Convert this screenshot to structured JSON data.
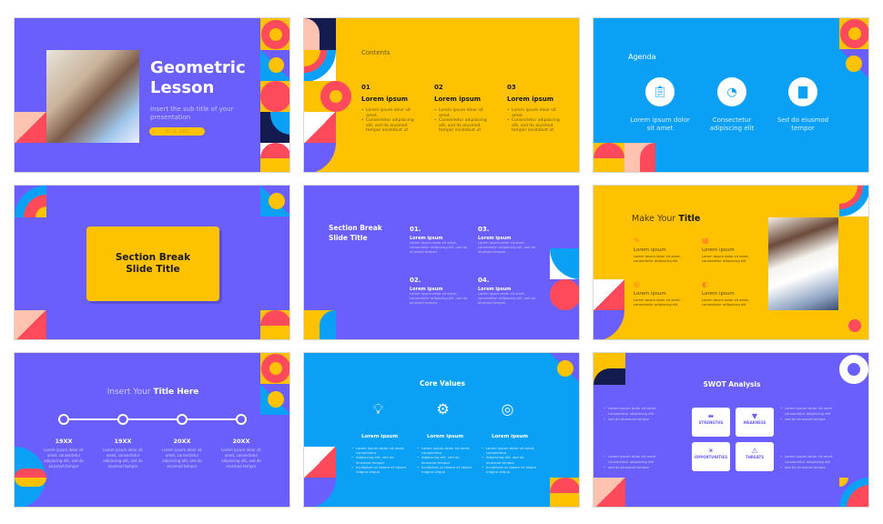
{
  "colors": {
    "purple": "#6a5ffd",
    "yellow": "#fec200",
    "blue": "#0aa0f5",
    "red": "#ff4a5c",
    "navy": "#141c4f",
    "peach": "#ffc3b0"
  },
  "slides": [
    {
      "title_line1": "Geometric",
      "title_line2": "Lesson",
      "subtitle": "Insert the sub title of your presentation",
      "date": "00. 00. 20XX"
    },
    {
      "heading": "Contents",
      "columns": [
        {
          "number": "01",
          "title": "Lorem ipsum",
          "bullets": [
            "Lorem ipsum dolor sit amet.",
            "Consectetur adipisicing elit, sed do eiusmod tempor incididunt ut"
          ]
        },
        {
          "number": "02",
          "title": "Lorem ipsum",
          "bullets": [
            "Lorem ipsum dolor sit amet.",
            "Consectetur adipisicing elit, sed do eiusmod tempor incididunt ut"
          ]
        },
        {
          "number": "03",
          "title": "Lorem ipsum",
          "bullets": [
            "Lorem ipsum dolor sit amet.",
            "Consectetur adipisicing elit, sed do eiusmod tempor incididunt ut"
          ]
        }
      ]
    },
    {
      "heading": "Agenda",
      "items": [
        {
          "icon": "clipboard-icon",
          "label": "Lorem ipsum dolor sit amet"
        },
        {
          "icon": "pie-chart-icon",
          "label": "Consectetur adipiscing elit"
        },
        {
          "icon": "bar-chart-icon",
          "label": "Sed do eiusmod tempor"
        }
      ]
    },
    {
      "title_line1": "Section Break",
      "title_line2": "Slide Title"
    },
    {
      "title_line1": "Section Break",
      "title_line2": "Slide Title",
      "items": [
        {
          "number": "01.",
          "title": "Lorem ipsum",
          "body": "Lorem ipsum dolor sit amet, consectetur adipiscing elit, sed do eiusmod tempor"
        },
        {
          "number": "03.",
          "title": "Lorem ipsum",
          "body": "Lorem ipsum dolor sit amet, consectetur adipiscing elit, sed do eiusmod tempor"
        },
        {
          "number": "02.",
          "title": "Lorem ipsum",
          "body": "Lorem ipsum dolor sit amet, consectetur adipiscing elit, sed do eiusmod tempor"
        },
        {
          "number": "04.",
          "title": "Lorem ipsum",
          "body": "Lorem ipsum dolor sit amet, consectetur adipiscing elit, sed do eiusmod tempor"
        }
      ]
    },
    {
      "title_light": "Make Your ",
      "title_bold": "Title",
      "items": [
        {
          "icon": "edit-icon",
          "title": "Lorem ipsum",
          "body": "Lorem ipsum dolor sit amet, consectetur adipiscing elit"
        },
        {
          "icon": "calendar-icon",
          "title": "Lorem ipsum",
          "body": "Lorem ipsum dolor sit amet, consectetur adipiscing elit"
        },
        {
          "icon": "target-icon",
          "title": "Lorem ipsum",
          "body": "Lorem ipsum dolor sit amet, consectetur adipiscing elit"
        },
        {
          "icon": "palette-icon",
          "title": "Lorem ipsum",
          "body": "Lorem ipsum dolor sit amet, consectetur adipiscing elit"
        }
      ]
    },
    {
      "title_light": "Insert Your ",
      "title_bold": "Title Here",
      "milestones": [
        {
          "year": "19XX",
          "body": "Lorem ipsum dolor sit amet, consectetur adipiscing elit, sed do eiusmod tempor"
        },
        {
          "year": "19XX",
          "body": "Lorem ipsum dolor sit amet, consectetur adipiscing elit, sed do eiusmod tempor"
        },
        {
          "year": "20XX",
          "body": "Lorem ipsum dolor sit amet, consectetur adipiscing elit, sed do eiusmod tempor"
        },
        {
          "year": "20XX",
          "body": "Lorem ipsum dolor sit amet, consectetur adipiscing elit, sed do eiusmod tempor"
        }
      ]
    },
    {
      "heading": "Core Values",
      "columns": [
        {
          "icon": "lightbulb-icon",
          "title": "Lorem ipsum",
          "bullets": [
            "Lorem ipsum dolor sit amet, consectetur",
            "Adipiscing elit, sed do eiusmod tempor",
            "Incididunt ut labore et dolore magna aliqua"
          ]
        },
        {
          "icon": "gear-search-icon",
          "title": "Lorem ipsum",
          "bullets": [
            "Lorem ipsum dolor sit amet, consectetur",
            "Adipiscing elit, sed do eiusmod tempor",
            "Incididunt ut labore et dolore magna aliqua"
          ]
        },
        {
          "icon": "target-icon",
          "title": "Lorem ipsum",
          "bullets": [
            "Lorem ipsum dolor sit amet, consectetur",
            "Adipiscing elit, sed do eiusmod tempor",
            "Incididunt ut labore et dolore magna aliqua"
          ]
        }
      ]
    },
    {
      "heading": "SWOT Analysis",
      "boxes": [
        {
          "icon": "dumbbell-icon",
          "label": "STRENGTHS"
        },
        {
          "icon": "thumbs-down-icon",
          "label": "WEAKNESS"
        },
        {
          "icon": "lightbulb-icon",
          "label": "OPPORTUNITIES"
        },
        {
          "icon": "warning-icon",
          "label": "THREATS"
        }
      ],
      "notes": [
        [
          "Lorem ipsum dolor sit amet consectetur adipiscing elit",
          "sed do eiusmod tempor"
        ],
        [
          "Lorem ipsum dolor sit amet consectetur adipiscing elit",
          "sed do eiusmod tempor"
        ],
        [
          "Lorem ipsum dolor sit amet consectetur adipiscing elit",
          "sed do eiusmod tempor"
        ],
        [
          "Lorem ipsum dolor sit amet consectetur adipiscing elit",
          "sed do eiusmod tempor"
        ]
      ]
    }
  ]
}
